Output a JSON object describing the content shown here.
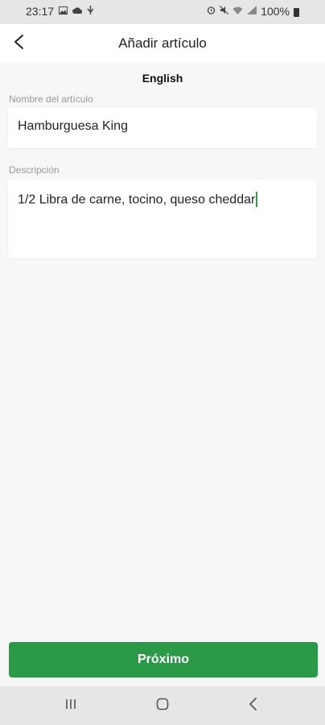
{
  "status_bar": {
    "time": "23:17",
    "battery": "100%",
    "icons_left": [
      "gallery-icon",
      "cloud-icon",
      "usb-icon"
    ],
    "icons_right": [
      "alarm-icon",
      "mute-icon",
      "wifi-icon",
      "signal-icon",
      "battery-icon"
    ]
  },
  "header": {
    "title": "Añadir artículo",
    "back_icon": "chevron-left-icon"
  },
  "form": {
    "language": "English",
    "name_label": "Nombre del artículo",
    "name_value": "Hamburguesa King",
    "description_label": "Descripción",
    "description_value": "1/2 Libra de carne, tocino, queso cheddar"
  },
  "footer": {
    "next_label": "Próximo"
  },
  "colors": {
    "accent": "#2a9a48",
    "background": "#f7f7f7",
    "system_bar": "#e6e6e6"
  },
  "nav_bar": {
    "buttons": [
      "recent-apps-icon",
      "home-icon",
      "back-icon"
    ]
  }
}
